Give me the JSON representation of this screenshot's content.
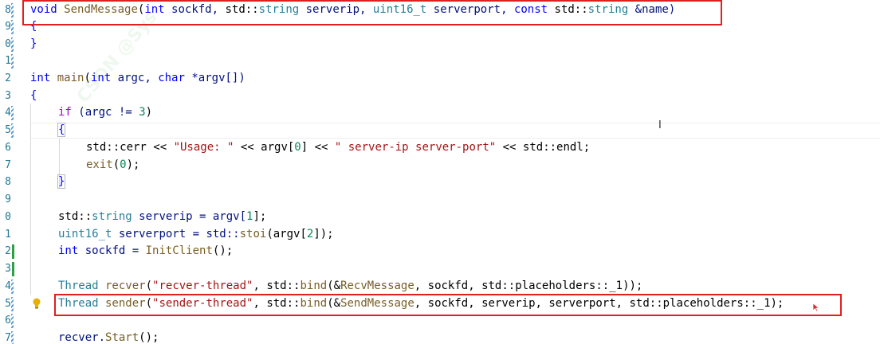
{
  "gutter": {
    "line_numbers": [
      "8",
      "9",
      "0",
      "1",
      "2",
      "3",
      "4",
      "5",
      "6",
      "7",
      "8",
      "9",
      "0",
      "1",
      "2",
      "3",
      "4",
      "5",
      "6",
      "7"
    ]
  },
  "code": {
    "l1": {
      "kw": "void",
      "fn": "SendMessage",
      "p1": "(",
      "t1": "int",
      "a1": " sockfd, ",
      "ns1": "std::",
      "t2": "string",
      "a2": " serverip, ",
      "t3": "uint16_t",
      "a3": " serverport, ",
      "kw2": "const",
      "ns2": " std::",
      "t4": "string",
      "a4": " &name)"
    },
    "l2": {
      "t": "{"
    },
    "l3": {
      "t": "}"
    },
    "l5": {
      "t1": "int",
      "fn": " main",
      "p": "(",
      "t2": "int",
      "a1": " argc, ",
      "t3": "char",
      "a2": " *argv[])"
    },
    "l6": {
      "t": "{"
    },
    "l7": {
      "kw": "if",
      "a": " (argc != ",
      "n": "3",
      "b": ")"
    },
    "l8": {
      "t": "{"
    },
    "l9": {
      "ns": "std::cerr << ",
      "s1": "\"Usage: \"",
      "m": " << argv[",
      "n": "0",
      "m2": "] << ",
      "s2": "\" server-ip server-port\"",
      "e": " << std::endl;"
    },
    "l10": {
      "fn": "exit",
      "p": "(",
      "n": "0",
      "e": ");"
    },
    "l11": {
      "t": "}"
    },
    "l13": {
      "ns": "std::",
      "t": "string",
      "a": " serverip = argv[",
      "n": "1",
      "e": "];"
    },
    "l14": {
      "t": "uint16_t",
      "a": " serverport = std::",
      "fn": "stoi",
      "b": "(argv[",
      "n": "2",
      "e": "]);"
    },
    "l15": {
      "t": "int",
      "a": " sockfd = ",
      "fn": "InitClient",
      "e": "();"
    },
    "l17": {
      "t": "Thread",
      "fn": " recver",
      "p": "(",
      "s": "\"recver-thread\"",
      "a": ", std::",
      "fn2": "bind",
      "b": "(&",
      "fn3": "RecvMessage",
      "c": ", sockfd, std::placeholders::_1));"
    },
    "l18": {
      "t": "Thread",
      "fn": " sender",
      "p": "(",
      "s": "\"sender-thread\"",
      "a": ", std::",
      "fn2": "bind",
      "b": "(&",
      "fn3": "SendMessage",
      "c": ", sockfd, serverip, serverport, std::placeholders::_1);"
    },
    "l20": {
      "a": "recver.",
      "fn": "Start",
      "e": "();"
    }
  },
  "colors": {
    "keyword": "#0000ff",
    "type": "#267f99",
    "function": "#795e26",
    "string": "#a31515",
    "number": "#098658",
    "highlight_box": "#e02020"
  }
}
